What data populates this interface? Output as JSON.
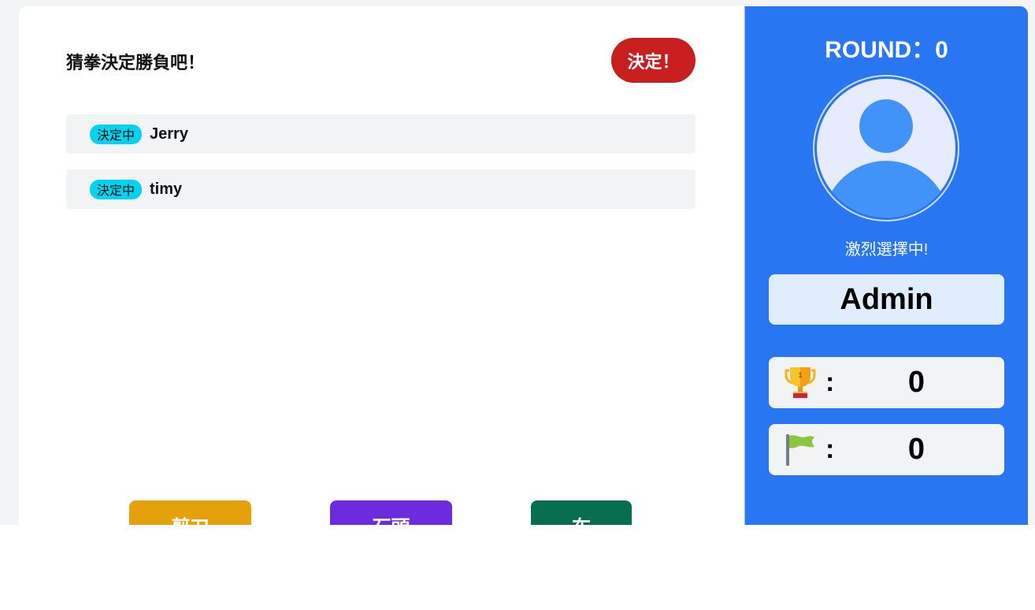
{
  "game": {
    "heading": "猜拳決定勝負吧！",
    "decide_label": "決定！",
    "players": [
      {
        "status": "決定中",
        "name": "Jerry"
      },
      {
        "status": "決定中",
        "name": "timy"
      }
    ],
    "choices": [
      {
        "label": "剪刀",
        "color": "#e4a10b"
      },
      {
        "label": "石頭",
        "color": "#6d2be0"
      },
      {
        "label": "布",
        "color": "#066e4f"
      }
    ]
  },
  "side": {
    "round_text": "ROUND：0",
    "avatar_icon": "user-avatar-icon",
    "status_text": "激烈選擇中!",
    "username": "Admin",
    "stats": [
      {
        "icon": "trophy-icon",
        "colon": ":",
        "value": "0"
      },
      {
        "icon": "flag-icon",
        "colon": ":",
        "value": "0"
      }
    ]
  },
  "colors": {
    "panel_blue": "#2876f2",
    "badge_cyan": "#00d2f0",
    "decide_red": "#c81e1e"
  }
}
